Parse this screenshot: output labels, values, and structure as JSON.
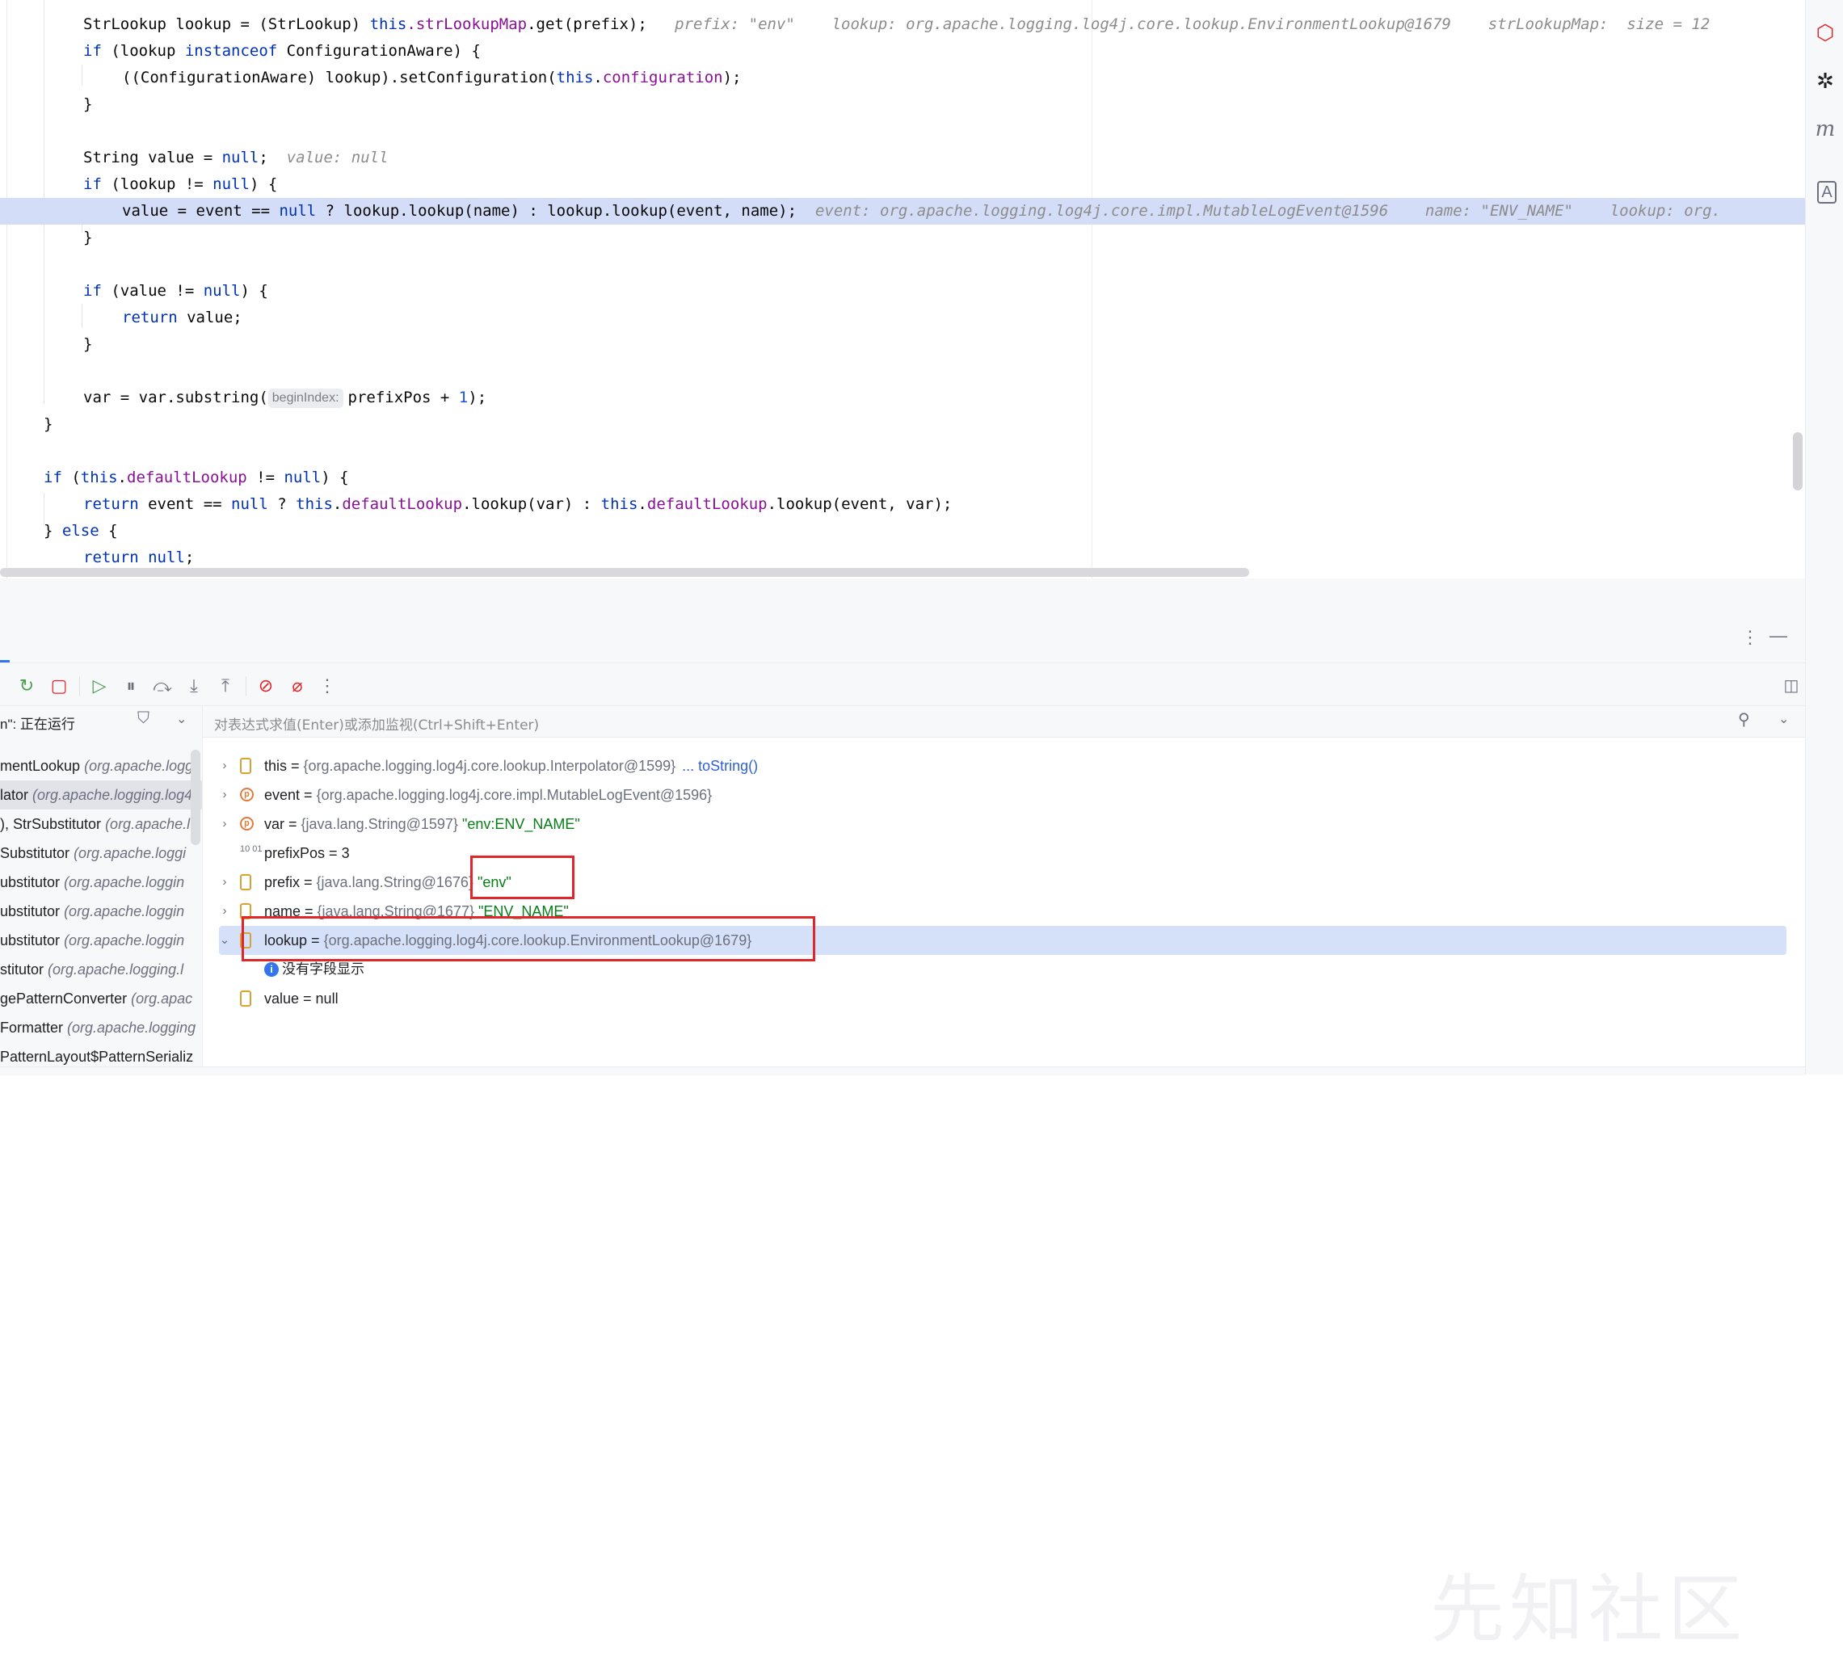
{
  "editor": {
    "lines": [
      {
        "t1": "StrLookup lookup = (StrLookup) ",
        "kw1": "this",
        "f1": ".strLookupMap",
        ".": "",
        "t2": ".get(prefix);",
        "hint": "prefix: \"env\"    lookup: org.apache.logging.log4j.core.lookup.EnvironmentLookup@1679    strLookupMap:  size = 12"
      },
      {
        "t": "if (lookup instanceof ConfigurationAware) {"
      },
      {
        "t": "((ConfigurationAware) lookup).setConfiguration(this.configuration);"
      },
      {
        "t": "}"
      },
      {
        "t": "String value = null;",
        "hint": "value: null"
      },
      {
        "t": "if (lookup != null) {"
      },
      {
        "t": "value = event == null ? lookup.lookup(name) : lookup.lookup(event, name);",
        "hint": "event: org.apache.logging.log4j.core.impl.MutableLogEvent@1596    name: \"ENV_NAME\"    lookup: org."
      },
      {
        "t": "}"
      },
      {
        "t": "if (value != null) {"
      },
      {
        "t": "return value;"
      },
      {
        "t": "}"
      },
      {
        "t": "var = var.substring(",
        "param": "beginIndex:",
        "t2": "prefixPos + 1);"
      },
      {
        "t": "}"
      },
      {
        "t": "if (this.defaultLookup != null) {"
      },
      {
        "t": "return event == null ? this.defaultLookup.lookup(var) : this.defaultLookup.lookup(event, var);"
      },
      {
        "t": "} else {"
      },
      {
        "t": "return null;"
      }
    ]
  },
  "debugger": {
    "thread_label": "n\": 正在运行",
    "eval_placeholder": "对表达式求值(Enter)或添加监视(Ctrl+Shift+Enter)",
    "frames": [
      {
        "name": "mentLookup",
        "pkg": "(org.apache.logg"
      },
      {
        "name": "lator",
        "pkg": "(org.apache.logging.log4"
      },
      {
        "name": "), StrSubstitutor",
        "pkg": "(org.apache.l"
      },
      {
        "name": "Substitutor",
        "pkg": "(org.apache.loggi"
      },
      {
        "name": "ubstitutor",
        "pkg": "(org.apache.loggin"
      },
      {
        "name": "ubstitutor",
        "pkg": "(org.apache.loggin"
      },
      {
        "name": "ubstitutor",
        "pkg": "(org.apache.loggin"
      },
      {
        "name": "stitutor",
        "pkg": "(org.apache.logging.l"
      },
      {
        "name": "gePatternConverter",
        "pkg": "(org.apac"
      },
      {
        "name": "Formatter",
        "pkg": "(org.apache.logging"
      },
      {
        "name": "PatternLayout$PatternSerializ",
        "pkg": ""
      }
    ],
    "vars": [
      {
        "name": "this",
        "eq": " = ",
        "type": "{org.apache.logging.log4j.core.lookup.Interpolator@1599}",
        "val": "",
        "link": "... toString()"
      },
      {
        "name": "event",
        "eq": " = ",
        "type": "{org.apache.logging.log4j.core.impl.MutableLogEvent@1596}",
        "val": "",
        "link": ""
      },
      {
        "name": "var",
        "eq": " = ",
        "type": "{java.lang.String@1597}",
        "val": " \"env:ENV_NAME\"",
        "link": ""
      },
      {
        "name": "prefixPos",
        "eq": " = ",
        "type": "",
        "val": "3",
        "link": ""
      },
      {
        "name": "prefix",
        "eq": " = ",
        "type": "{java.lang.String@1676}",
        "val": " \"env\"",
        "link": ""
      },
      {
        "name": "name",
        "eq": " = ",
        "type": "{java.lang.String@1677}",
        "val": " \"ENV_NAME\"",
        "link": ""
      },
      {
        "name": "lookup",
        "eq": " = ",
        "type": "{org.apache.logging.log4j.core.lookup.EnvironmentLookup@1679}",
        "val": "",
        "link": ""
      },
      {
        "name": "",
        "eq": "",
        "type": "",
        "val": "",
        "link": "",
        "info": "没有字段显示"
      },
      {
        "name": "value",
        "eq": " = ",
        "type": "",
        "val": "null",
        "link": ""
      }
    ]
  },
  "watermark": "先知社区",
  "colors": {
    "accent": "#3574f0",
    "highlight": "#d3ddf7",
    "redbox": "#e0262a"
  }
}
